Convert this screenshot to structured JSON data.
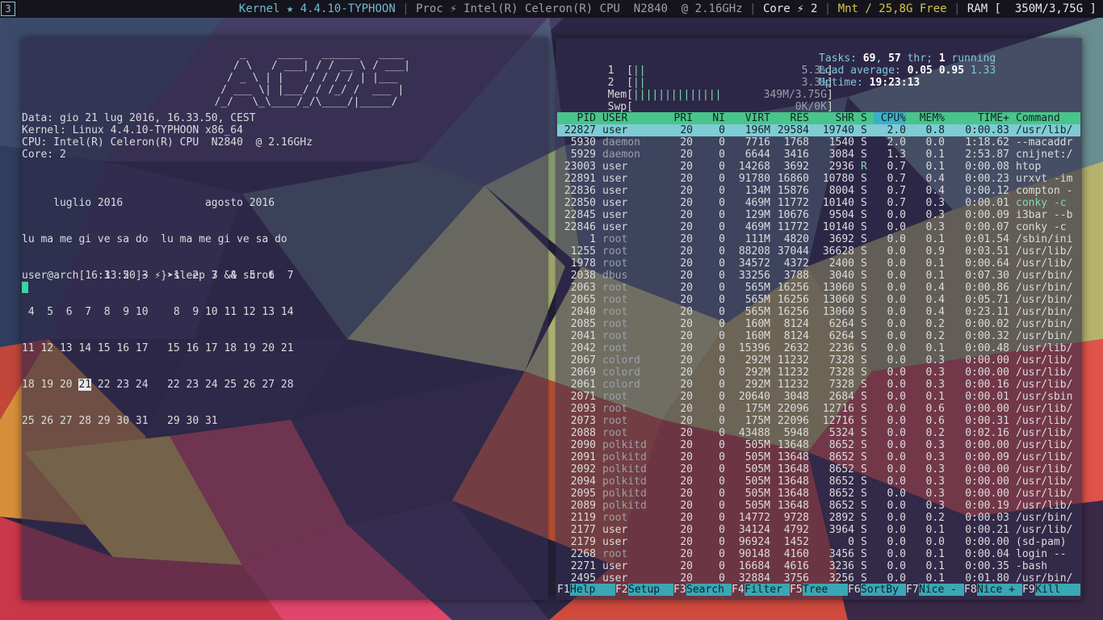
{
  "topbar": {
    "workspace": "3",
    "segments": [
      {
        "text": "Kernel ★ 4.4.10-TYPHOON",
        "color": "#6fbad0"
      },
      {
        "text": "Proc ⚡ Intel(R) Celeron(R) CPU  N2840  @ 2.16GHz",
        "color": "#9aa0aa"
      },
      {
        "text": "Core ⚡ 2",
        "color": "#e8e8e8"
      },
      {
        "text": "Mnt / 25,8G Free",
        "color": "#d6c64b"
      },
      {
        "text": "RAM [  350M/3,75G ]",
        "color": "#e8e8e8"
      }
    ]
  },
  "left_terminal": {
    "logo_lines": [
      "       _     ____   ______   ____",
      "      / \\   / ___| / / __ \\ / ___|",
      "     / _ \\ | |    / / / / | |___",
      "    / ___ \\| |___/ / /_/ /  ___ |",
      "   /_/   \\_\\____/_/\\____/|_____/"
    ],
    "info_lines": [
      "Data: gio 21 lug 2016, 16.33.50, CEST",
      "Kernel: Linux 4.4.10-TYPHOON x86_64",
      "CPU: Intel(R) Celeron(R) CPU  N2840  @ 2.16GHz",
      "Core: 2"
    ],
    "calendar": {
      "title_row": "     luglio 2016             agosto 2016",
      "weekday_row": "lu ma me gi ve sa do  lu ma me gi ve sa do",
      "rows_before": [
        "             1  2  3    1  2  3  4  5  6  7",
        " 4  5  6  7  8  9 10    8  9 10 11 12 13 14",
        "11 12 13 14 15 16 17   15 16 17 18 19 20 21"
      ],
      "today_row_pre": "18 19 20 ",
      "today": "21",
      "today_row_post": " 22 23 24   22 23 24 25 26 27 28",
      "rows_after": [
        "25 26 27 28 29 30 31   29 30 31"
      ]
    },
    "prompt": "user@arch[16:33:50]~ ⚡}➤sleep 7 && scrot"
  },
  "htop": {
    "cpu1": {
      "label": "  1  ",
      "bar": "||",
      "value": "5.3%",
      "usage_percent": 5.3
    },
    "cpu2": {
      "label": "  2  ",
      "bar": "||",
      "value": "3.3%",
      "usage_percent": 3.3
    },
    "mem": {
      "label": "  Mem",
      "bar": "||||||||||||||",
      "value": "349M/3.75G"
    },
    "swp": {
      "label": "  Swp",
      "bar": "",
      "value": "0K/0K"
    },
    "tasks_label": "Tasks: ",
    "tasks": "69",
    "thr_count": "57",
    "thr_label": " thr; ",
    "running_count": "1",
    "running_label": " running",
    "load_label": "Load average: ",
    "load1": "0.05",
    "load5": "0.95",
    "load15": "1.33",
    "uptime_label": "Uptime: ",
    "uptime": "19:23:13",
    "columns": [
      "PID",
      "USER",
      "PRI",
      "NI",
      "VIRT",
      "RES",
      "SHR",
      "S",
      "CPU%",
      "MEM%",
      "TIME+",
      "Command"
    ],
    "processes": [
      {
        "pid": "22827",
        "user": "user",
        "pri": "20",
        "ni": "0",
        "virt": "196M",
        "res": "29584",
        "shr": "19740",
        "s": "S",
        "cpu": "2.0",
        "mem": "0.8",
        "time": "0:00.83",
        "cmd": "/usr/lib/"
      },
      {
        "pid": "5930",
        "user": "daemon",
        "pri": "20",
        "ni": "0",
        "virt": "7716",
        "res": "1768",
        "shr": "1540",
        "s": "S",
        "cpu": "2.0",
        "mem": "0.0",
        "time": "1:18.62",
        "cmd": "--macaddr"
      },
      {
        "pid": "5929",
        "user": "daemon",
        "pri": "20",
        "ni": "0",
        "virt": "6644",
        "res": "3416",
        "shr": "3084",
        "s": "S",
        "cpu": "1.3",
        "mem": "0.1",
        "time": "2:53.87",
        "cmd": "cnijnet:/"
      },
      {
        "pid": "23003",
        "user": "user",
        "pri": "20",
        "ni": "0",
        "virt": "14268",
        "res": "3692",
        "shr": "2936",
        "s": "R",
        "cpu": "0.7",
        "mem": "0.1",
        "time": "0:00.08",
        "cmd": "htop"
      },
      {
        "pid": "22891",
        "user": "user",
        "pri": "20",
        "ni": "0",
        "virt": "91780",
        "res": "16860",
        "shr": "10780",
        "s": "S",
        "cpu": "0.7",
        "mem": "0.4",
        "time": "0:00.23",
        "cmd": "urxvt -im"
      },
      {
        "pid": "22836",
        "user": "user",
        "pri": "20",
        "ni": "0",
        "virt": "134M",
        "res": "15876",
        "shr": "8004",
        "s": "S",
        "cpu": "0.7",
        "mem": "0.4",
        "time": "0:00.12",
        "cmd": "compton -"
      },
      {
        "pid": "22850",
        "user": "user",
        "pri": "20",
        "ni": "0",
        "virt": "469M",
        "res": "11772",
        "shr": "10140",
        "s": "S",
        "cpu": "0.7",
        "mem": "0.3",
        "time": "0:00.01",
        "cmd": "conky -c"
      },
      {
        "pid": "22845",
        "user": "user",
        "pri": "20",
        "ni": "0",
        "virt": "129M",
        "res": "10676",
        "shr": "9504",
        "s": "S",
        "cpu": "0.0",
        "mem": "0.3",
        "time": "0:00.09",
        "cmd": "i3bar --b"
      },
      {
        "pid": "22846",
        "user": "user",
        "pri": "20",
        "ni": "0",
        "virt": "469M",
        "res": "11772",
        "shr": "10140",
        "s": "S",
        "cpu": "0.0",
        "mem": "0.3",
        "time": "0:00.07",
        "cmd": "conky -c"
      },
      {
        "pid": "1",
        "user": "root",
        "pri": "20",
        "ni": "0",
        "virt": "111M",
        "res": "4820",
        "shr": "3692",
        "s": "S",
        "cpu": "0.0",
        "mem": "0.1",
        "time": "0:01.54",
        "cmd": "/sbin/ini"
      },
      {
        "pid": "1255",
        "user": "root",
        "pri": "20",
        "ni": "0",
        "virt": "88208",
        "res": "37044",
        "shr": "36628",
        "s": "S",
        "cpu": "0.0",
        "mem": "0.9",
        "time": "0:03.51",
        "cmd": "/usr/lib/"
      },
      {
        "pid": "1978",
        "user": "root",
        "pri": "20",
        "ni": "0",
        "virt": "34572",
        "res": "4372",
        "shr": "2400",
        "s": "S",
        "cpu": "0.0",
        "mem": "0.1",
        "time": "0:00.64",
        "cmd": "/usr/lib/"
      },
      {
        "pid": "2038",
        "user": "dbus",
        "pri": "20",
        "ni": "0",
        "virt": "33256",
        "res": "3788",
        "shr": "3040",
        "s": "S",
        "cpu": "0.0",
        "mem": "0.1",
        "time": "0:07.30",
        "cmd": "/usr/bin/"
      },
      {
        "pid": "2063",
        "user": "root",
        "pri": "20",
        "ni": "0",
        "virt": "565M",
        "res": "16256",
        "shr": "13060",
        "s": "S",
        "cpu": "0.0",
        "mem": "0.4",
        "time": "0:00.86",
        "cmd": "/usr/bin/"
      },
      {
        "pid": "2065",
        "user": "root",
        "pri": "20",
        "ni": "0",
        "virt": "565M",
        "res": "16256",
        "shr": "13060",
        "s": "S",
        "cpu": "0.0",
        "mem": "0.4",
        "time": "0:05.71",
        "cmd": "/usr/bin/"
      },
      {
        "pid": "2040",
        "user": "root",
        "pri": "20",
        "ni": "0",
        "virt": "565M",
        "res": "16256",
        "shr": "13060",
        "s": "S",
        "cpu": "0.0",
        "mem": "0.4",
        "time": "0:23.11",
        "cmd": "/usr/bin/"
      },
      {
        "pid": "2085",
        "user": "root",
        "pri": "20",
        "ni": "0",
        "virt": "160M",
        "res": "8124",
        "shr": "6264",
        "s": "S",
        "cpu": "0.0",
        "mem": "0.2",
        "time": "0:00.02",
        "cmd": "/usr/bin/"
      },
      {
        "pid": "2041",
        "user": "root",
        "pri": "20",
        "ni": "0",
        "virt": "160M",
        "res": "8124",
        "shr": "6264",
        "s": "S",
        "cpu": "0.0",
        "mem": "0.2",
        "time": "0:00.32",
        "cmd": "/usr/bin/"
      },
      {
        "pid": "2042",
        "user": "root",
        "pri": "20",
        "ni": "0",
        "virt": "15396",
        "res": "2632",
        "shr": "2236",
        "s": "S",
        "cpu": "0.0",
        "mem": "0.1",
        "time": "0:00.48",
        "cmd": "/usr/lib/"
      },
      {
        "pid": "2067",
        "user": "colord",
        "pri": "20",
        "ni": "0",
        "virt": "292M",
        "res": "11232",
        "shr": "7328",
        "s": "S",
        "cpu": "0.0",
        "mem": "0.3",
        "time": "0:00.00",
        "cmd": "/usr/lib/"
      },
      {
        "pid": "2069",
        "user": "colord",
        "pri": "20",
        "ni": "0",
        "virt": "292M",
        "res": "11232",
        "shr": "7328",
        "s": "S",
        "cpu": "0.0",
        "mem": "0.3",
        "time": "0:00.00",
        "cmd": "/usr/lib/"
      },
      {
        "pid": "2061",
        "user": "colord",
        "pri": "20",
        "ni": "0",
        "virt": "292M",
        "res": "11232",
        "shr": "7328",
        "s": "S",
        "cpu": "0.0",
        "mem": "0.3",
        "time": "0:00.16",
        "cmd": "/usr/lib/"
      },
      {
        "pid": "2071",
        "user": "root",
        "pri": "20",
        "ni": "0",
        "virt": "20640",
        "res": "3048",
        "shr": "2684",
        "s": "S",
        "cpu": "0.0",
        "mem": "0.1",
        "time": "0:00.01",
        "cmd": "/usr/sbin"
      },
      {
        "pid": "2093",
        "user": "root",
        "pri": "20",
        "ni": "0",
        "virt": "175M",
        "res": "22096",
        "shr": "12716",
        "s": "S",
        "cpu": "0.0",
        "mem": "0.6",
        "time": "0:00.00",
        "cmd": "/usr/lib/"
      },
      {
        "pid": "2073",
        "user": "root",
        "pri": "20",
        "ni": "0",
        "virt": "175M",
        "res": "22096",
        "shr": "12716",
        "s": "S",
        "cpu": "0.0",
        "mem": "0.6",
        "time": "0:00.31",
        "cmd": "/usr/lib/"
      },
      {
        "pid": "2088",
        "user": "root",
        "pri": "20",
        "ni": "0",
        "virt": "43488",
        "res": "5948",
        "shr": "5324",
        "s": "S",
        "cpu": "0.0",
        "mem": "0.2",
        "time": "0:02.16",
        "cmd": "/usr/lib/"
      },
      {
        "pid": "2090",
        "user": "polkitd",
        "pri": "20",
        "ni": "0",
        "virt": "505M",
        "res": "13648",
        "shr": "8652",
        "s": "S",
        "cpu": "0.0",
        "mem": "0.3",
        "time": "0:00.00",
        "cmd": "/usr/lib/"
      },
      {
        "pid": "2091",
        "user": "polkitd",
        "pri": "20",
        "ni": "0",
        "virt": "505M",
        "res": "13648",
        "shr": "8652",
        "s": "S",
        "cpu": "0.0",
        "mem": "0.3",
        "time": "0:00.09",
        "cmd": "/usr/lib/"
      },
      {
        "pid": "2092",
        "user": "polkitd",
        "pri": "20",
        "ni": "0",
        "virt": "505M",
        "res": "13648",
        "shr": "8652",
        "s": "S",
        "cpu": "0.0",
        "mem": "0.3",
        "time": "0:00.00",
        "cmd": "/usr/lib/"
      },
      {
        "pid": "2094",
        "user": "polkitd",
        "pri": "20",
        "ni": "0",
        "virt": "505M",
        "res": "13648",
        "shr": "8652",
        "s": "S",
        "cpu": "0.0",
        "mem": "0.3",
        "time": "0:00.00",
        "cmd": "/usr/lib/"
      },
      {
        "pid": "2095",
        "user": "polkitd",
        "pri": "20",
        "ni": "0",
        "virt": "505M",
        "res": "13648",
        "shr": "8652",
        "s": "S",
        "cpu": "0.0",
        "mem": "0.3",
        "time": "0:00.00",
        "cmd": "/usr/lib/"
      },
      {
        "pid": "2089",
        "user": "polkitd",
        "pri": "20",
        "ni": "0",
        "virt": "505M",
        "res": "13648",
        "shr": "8652",
        "s": "S",
        "cpu": "0.0",
        "mem": "0.3",
        "time": "0:00.19",
        "cmd": "/usr/lib/"
      },
      {
        "pid": "2119",
        "user": "root",
        "pri": "20",
        "ni": "0",
        "virt": "14772",
        "res": "9728",
        "shr": "2892",
        "s": "S",
        "cpu": "0.0",
        "mem": "0.2",
        "time": "0:00.03",
        "cmd": "/usr/bin/"
      },
      {
        "pid": "2177",
        "user": "user",
        "pri": "20",
        "ni": "0",
        "virt": "34124",
        "res": "4792",
        "shr": "3964",
        "s": "S",
        "cpu": "0.0",
        "mem": "0.1",
        "time": "0:00.21",
        "cmd": "/usr/lib/"
      },
      {
        "pid": "2179",
        "user": "user",
        "pri": "20",
        "ni": "0",
        "virt": "96924",
        "res": "1452",
        "shr": "0",
        "s": "S",
        "cpu": "0.0",
        "mem": "0.0",
        "time": "0:00.00",
        "cmd": "(sd-pam)"
      },
      {
        "pid": "2268",
        "user": "root",
        "pri": "20",
        "ni": "0",
        "virt": "90148",
        "res": "4160",
        "shr": "3456",
        "s": "S",
        "cpu": "0.0",
        "mem": "0.1",
        "time": "0:00.04",
        "cmd": "login --"
      },
      {
        "pid": "2271",
        "user": "user",
        "pri": "20",
        "ni": "0",
        "virt": "16684",
        "res": "4616",
        "shr": "3236",
        "s": "S",
        "cpu": "0.0",
        "mem": "0.1",
        "time": "0:00.35",
        "cmd": "-bash"
      },
      {
        "pid": "2495",
        "user": "user",
        "pri": "20",
        "ni": "0",
        "virt": "32884",
        "res": "3756",
        "shr": "3256",
        "s": "S",
        "cpu": "0.0",
        "mem": "0.1",
        "time": "0:01.80",
        "cmd": "/usr/bin/"
      }
    ],
    "function_keys": [
      {
        "key": "F1",
        "label": "Help  "
      },
      {
        "key": "F2",
        "label": "Setup "
      },
      {
        "key": "F3",
        "label": "Search"
      },
      {
        "key": "F4",
        "label": "Filter"
      },
      {
        "key": "F5",
        "label": "Tree  "
      },
      {
        "key": "F6",
        "label": "SortBy"
      },
      {
        "key": "F7",
        "label": "Nice -"
      },
      {
        "key": "F8",
        "label": "Nice +"
      },
      {
        "key": "F9",
        "label": "Kill  "
      }
    ]
  },
  "colors": {
    "header_bg": "#48c58a",
    "selected_row_bg": "#7ecbd4",
    "sort_column_bg": "#3ab0c9",
    "fkey_label_bg": "#3aa7b4",
    "cursor": "#3fd1a0"
  }
}
